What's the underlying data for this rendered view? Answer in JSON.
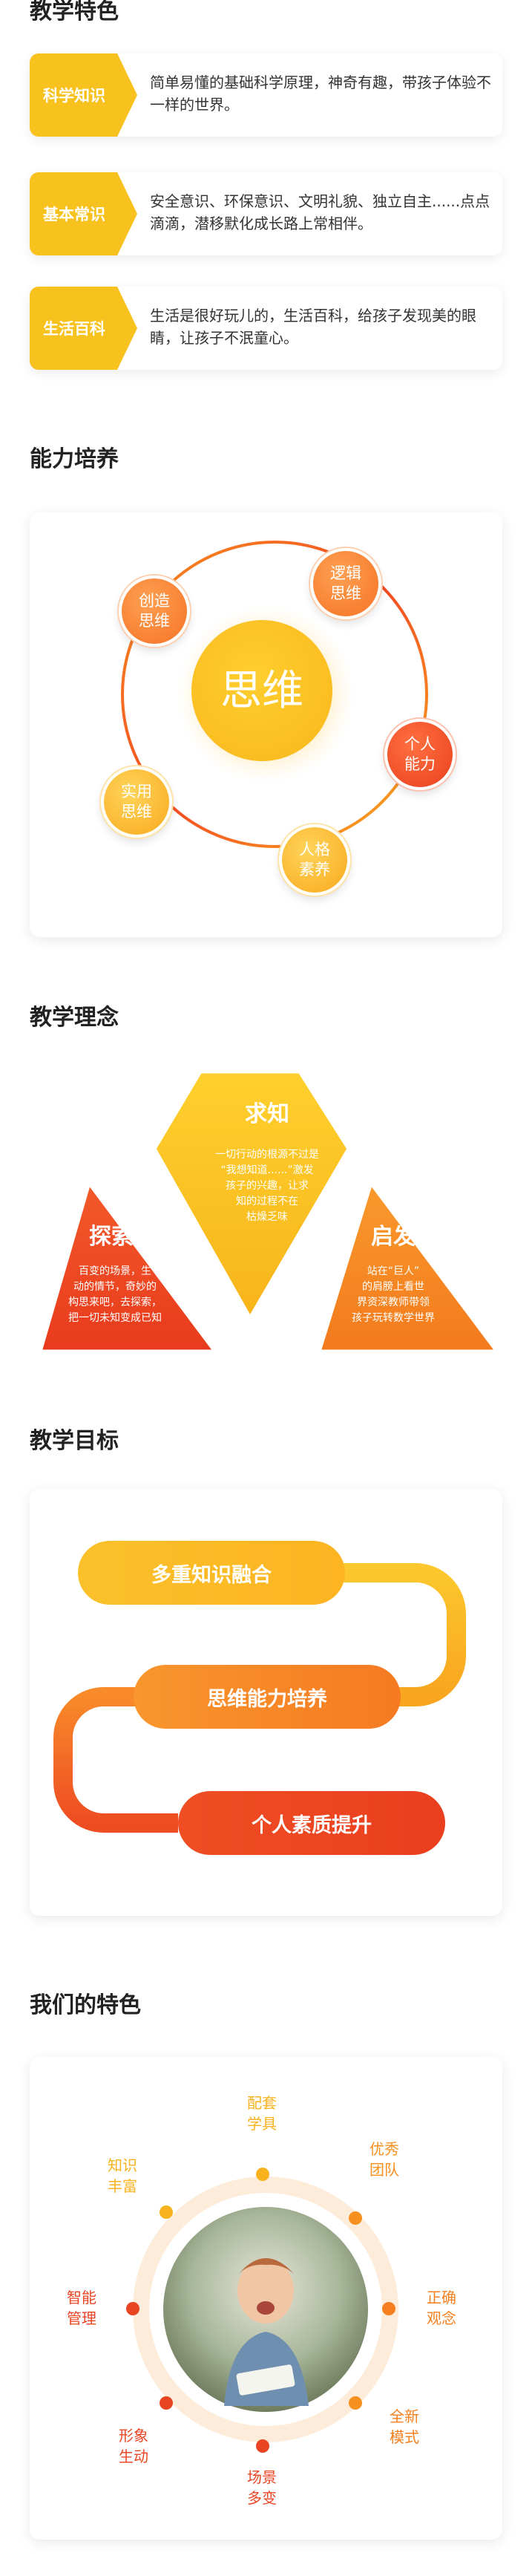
{
  "sections": {
    "teaching_features": "教学特色",
    "ability": "能力培养",
    "philosophy": "教学理念",
    "goals": "教学目标",
    "our_features": "我们的特色"
  },
  "teaching_features": [
    {
      "tag": "科学知识",
      "text": "简单易懂的基础科学原理，神奇有趣，带孩子体验不一样的世界。"
    },
    {
      "tag": "基本常识",
      "text": "安全意识、环保意识、文明礼貌、独立自主......点点滴滴，潜移默化成长路上常相伴。"
    },
    {
      "tag": "生活百科",
      "text": "生活是很好玩儿的，生活百科，给孩子发现美的眼睛，让孩子不泯童心。"
    }
  ],
  "ability": {
    "center": "思维",
    "nodes": [
      "创造\n思维",
      "逻辑\n思维",
      "个人\n能力",
      "人格\n素养",
      "实用\n思维"
    ]
  },
  "philosophy": {
    "top": {
      "title": "求知",
      "text": "一切行动的根源不过是\n“我想知道......”激发\n孩子的兴趣，让求\n知的过程不在\n枯燥乏味"
    },
    "left": {
      "title": "探索",
      "text": "百变的场景，生\n动的情节，奇妙的\n构思来吧，去探索，\n把一切未知变成已知"
    },
    "right": {
      "title": "启发",
      "text": "站在“巨人”\n的肩膀上看世\n界资深教师带领\n孩子玩转数学世界"
    }
  },
  "goals": [
    "多重知识融合",
    "思维能力培养",
    "个人素质提升"
  ],
  "our_features": {
    "labels": [
      "配套\n学具",
      "优秀\n团队",
      "正确\n观念",
      "全新\n模式",
      "场景\n多变",
      "形象\n生动",
      "智能\n管理",
      "知识\n丰富"
    ]
  },
  "colors": {
    "yellow": "#f8c21e",
    "orange": "#f6801f",
    "red": "#ea4523"
  }
}
